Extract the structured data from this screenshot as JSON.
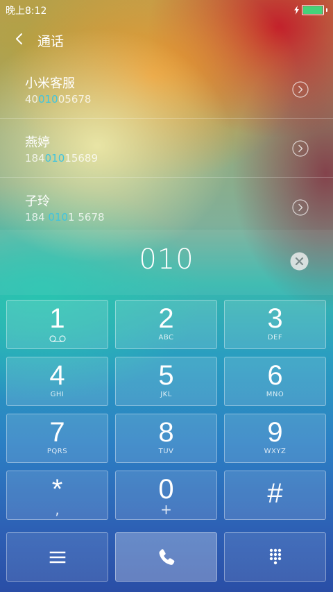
{
  "status_bar": {
    "time": "晚上8:12",
    "battery_color": "#45d27a",
    "battery_level": 1.0
  },
  "header": {
    "back_icon": "back-chevron-icon",
    "title": "通话"
  },
  "results": [
    {
      "name": "小米客服",
      "number_pre": "40",
      "number_match": "010",
      "number_post": "05678"
    },
    {
      "name": "燕婷",
      "number_pre": "184",
      "number_match": "010",
      "number_post": "15689"
    },
    {
      "name": "子玲",
      "number_pre": "184 ",
      "number_match": "010",
      "number_post": "1 5678"
    }
  ],
  "highlight_color": "#3fc4df",
  "dial": {
    "value": "010",
    "clear_icon": "clear-icon"
  },
  "keypad": [
    {
      "digit": "1",
      "letters": "",
      "icon": "voicemail-icon"
    },
    {
      "digit": "2",
      "letters": "ABC"
    },
    {
      "digit": "3",
      "letters": "DEF"
    },
    {
      "digit": "4",
      "letters": "GHI"
    },
    {
      "digit": "5",
      "letters": "JKL"
    },
    {
      "digit": "6",
      "letters": "MNO"
    },
    {
      "digit": "7",
      "letters": "PQRS"
    },
    {
      "digit": "8",
      "letters": "TUV"
    },
    {
      "digit": "9",
      "letters": "WXYZ"
    },
    {
      "digit": "*",
      "letters": ",",
      "letters_large": true
    },
    {
      "digit": "0",
      "letters": "+",
      "letters_large": true
    },
    {
      "digit": "#",
      "letters": ""
    }
  ],
  "actions": {
    "menu_icon": "menu-icon",
    "call_icon": "phone-icon",
    "keypad_icon": "dialpad-icon"
  }
}
